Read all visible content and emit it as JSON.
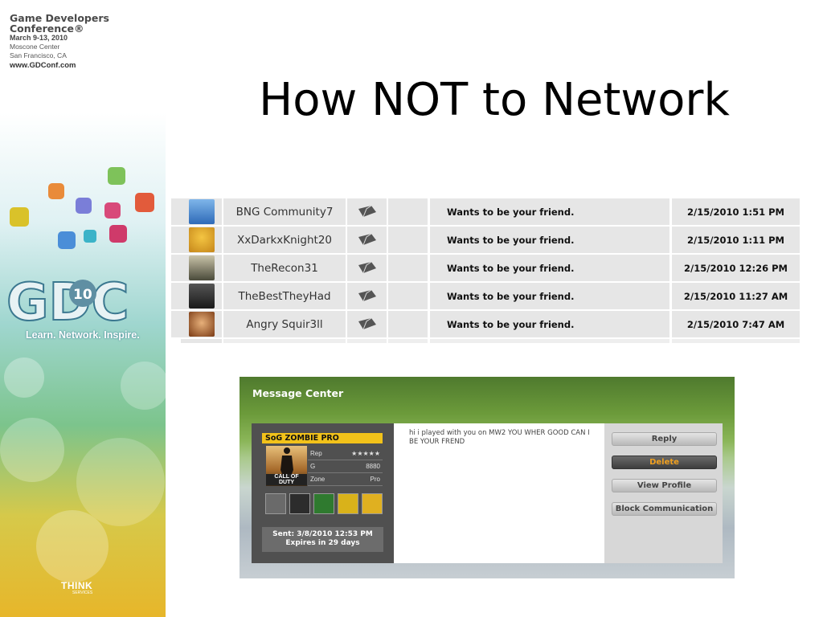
{
  "conference": {
    "name_line1": "Game Developers",
    "name_line2": "Conference®",
    "dates": "March 9-13, 2010",
    "venue": "Moscone Center",
    "city": "San Francisco, CA",
    "url": "www.GDConf.com",
    "tagline": "Learn. Network. Inspire.",
    "sponsor": "THINK",
    "sponsor_sub": "SERVICES"
  },
  "slide": {
    "title": "How NOT to Network"
  },
  "friend_requests": [
    {
      "name": "BNG Community7",
      "message": "Wants to be your friend.",
      "date": "2/15/2010 1:51 PM",
      "avatar_color": "#4a8fd6"
    },
    {
      "name": "XxDarkxKnight20",
      "message": "Wants to be your friend.",
      "date": "2/15/2010 1:11 PM",
      "avatar_color": "#e0a020"
    },
    {
      "name": "TheRecon31",
      "message": "Wants to be your friend.",
      "date": "2/15/2010 12:26 PM",
      "avatar_color": "#6b6b5a"
    },
    {
      "name": "TheBestTheyHad",
      "message": "Wants to be your friend.",
      "date": "2/15/2010 11:27 AM",
      "avatar_color": "#3a3a3a"
    },
    {
      "name": "Angry Squir3ll",
      "message": "Wants to be your friend.",
      "date": "2/15/2010 7:47 AM",
      "avatar_color": "#b8742a"
    }
  ],
  "message_center": {
    "title": "Message Center",
    "gamer": {
      "gamertag": "SoG ZOMBIE PRO",
      "game_label": "CALL OF DUTY",
      "stats": [
        {
          "key": "Rep",
          "value": "★★★★★"
        },
        {
          "key": "G",
          "value": "8880"
        },
        {
          "key": "Zone",
          "value": "Pro"
        }
      ],
      "badge_colors": [
        "#5a5a5a",
        "#3c3c3c",
        "#2f7a2f",
        "#d9b21a",
        "#e0b020"
      ]
    },
    "sent": "Sent: 3/8/2010 12:53 PM",
    "expires": "Expires in 29 days",
    "message": "hi i played with you on MW2 YOU WHER GOOD CAN I BE YOUR FREND",
    "buttons": {
      "reply": "Reply",
      "delete": "Delete",
      "view_profile": "View Profile",
      "block": "Block Communication"
    }
  }
}
